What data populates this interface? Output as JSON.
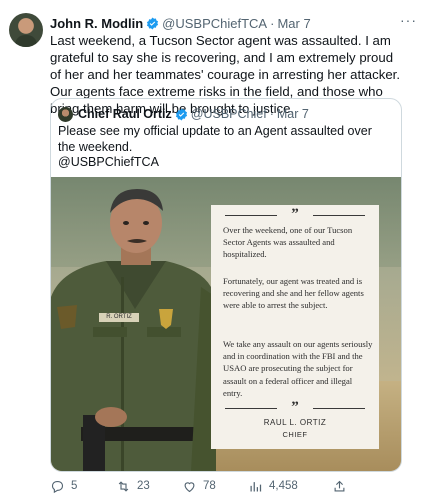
{
  "tweet": {
    "author_name": "John R. Modlin",
    "handle": "@USBPChiefTCA",
    "separator": "·",
    "date": "Mar 7",
    "more_icon": "more-icon",
    "text": "Last weekend, a Tucson Sector agent was assaulted. I am grateful to say she is recovering, and I am extremely proud of her and her teammates' courage in arresting her attacker. Our agents face extreme risks in the field, and those who bring them harm will be brought to justice."
  },
  "quote": {
    "author_name": "Chief Raul Ortiz",
    "handle": "@USBPChief",
    "separator": "·",
    "date": "Mar 7",
    "text_line1": "Please see my official update to an Agent assaulted over the weekend.",
    "text_line2": "@USBPChiefTCA",
    "image": {
      "quote_mark": "”",
      "paragraph1": "Over the weekend, one of our Tucson Sector Agents was assaulted and hospitalized.",
      "paragraph2": "Fortunately, our agent was treated and is recovering and she and her fellow agents were able to arrest the subject.",
      "paragraph3": "We take any assault on our agents seriously and in coordination with the FBI and the USAO are prosecuting the subject for assault on a federal officer and illegal entry.",
      "closing_quote_mark": "”",
      "signature_name": "RAUL L. ORTIZ",
      "signature_title": "CHIEF",
      "name_tag": "R. ORTIZ"
    }
  },
  "actions": {
    "replies": "5",
    "retweets": "23",
    "likes": "78",
    "views": "4,458"
  },
  "colors": {
    "verified_blue": "#1d9bf0",
    "muted_text": "#536471",
    "border": "#cfd9de",
    "uniform_green": "#4e5b3b"
  }
}
